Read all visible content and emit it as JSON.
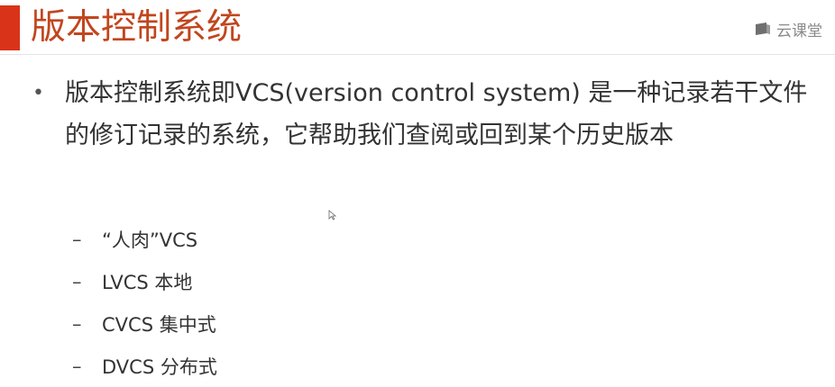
{
  "slide": {
    "title": "版本控制系统",
    "brand": {
      "icon": "cloud-classroom-icon",
      "label": "云课堂"
    },
    "bullet": {
      "marker": "•",
      "text": "版本控制系统即VCS(version control system) 是一种记录若干文件的修订记录的系统，它帮助我们查阅或回到某个历史版本"
    },
    "sub_items": [
      {
        "marker": "–",
        "text": "“人肉”VCS"
      },
      {
        "marker": "–",
        "text": "LVCS 本地"
      },
      {
        "marker": "–",
        "text": "CVCS 集中式"
      },
      {
        "marker": "–",
        "text": "DVCS 分布式"
      }
    ]
  },
  "colors": {
    "title_accent": "#d9331a",
    "title_text": "#c1461e",
    "body_text": "#333333",
    "brand_text": "#8a8a8a"
  }
}
